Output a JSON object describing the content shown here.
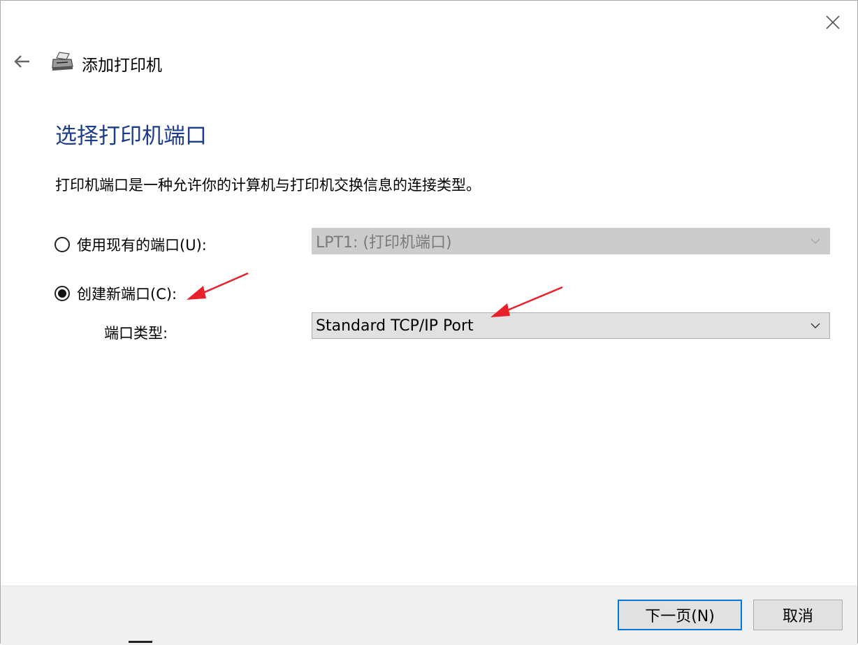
{
  "window": {
    "title": "添加打印机",
    "close_icon": "close-icon",
    "back_icon": "back-arrow-icon",
    "printer_icon": "printer-icon"
  },
  "page": {
    "heading": "选择打印机端口",
    "description": "打印机端口是一种允许你的计算机与打印机交换信息的连接类型。"
  },
  "options": {
    "existing": {
      "label": "使用现有的端口(U):",
      "selected": false,
      "enabled": false,
      "value": "LPT1: (打印机端口)"
    },
    "create_new": {
      "label": "创建新端口(C):",
      "selected": true,
      "port_type_label": "端口类型:",
      "value": "Standard TCP/IP Port"
    }
  },
  "buttons": {
    "next": "下一页(N)",
    "cancel": "取消"
  },
  "colors": {
    "heading": "#1c3c8c",
    "annotation_arrow": "#e8202a",
    "focus_border": "#0078d7"
  }
}
